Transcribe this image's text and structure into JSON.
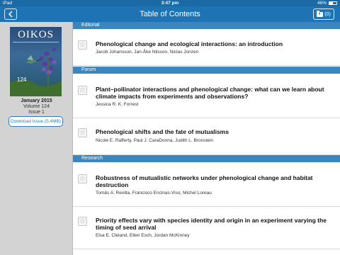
{
  "status": {
    "device": "iPad",
    "time": "3:47 pm",
    "battery": "46%",
    "battery_level": 0.46
  },
  "nav": {
    "back_icon": "chevron-left-icon",
    "title": "Table of Contents",
    "downloads_count": "(0)",
    "downloads_icon": "folder-download-icon"
  },
  "issue": {
    "cover_logo": "OIKOS",
    "cover_number": "124",
    "date": "January 2015",
    "volume": "Volume 124",
    "number": "Issue 1",
    "download_label": "Download Issue (5.4MB)"
  },
  "sections": [
    {
      "name": "Editorial"
    },
    {
      "name": "Forum"
    },
    {
      "name": "Research"
    }
  ],
  "articles": [
    {
      "title": "Phenological change and ecological interactions: an introduction",
      "authors": "Jacob Johansson, Jan-Åke Nilsson, Niclas Jonzen"
    },
    {
      "title": "Plant–pollinator interactions and phenological change: what can we learn about climate impacts from experiments and observations?",
      "authors": "Jessica R. K. Forrest"
    },
    {
      "title": "Phenological shifts and the fate of mutualisms",
      "authors": "Nicole E. Rafferty, Paul J. CaraDonna, Judith L. Bronstein"
    },
    {
      "title": "Robustness of mutualistic networks under phenological change and habitat destruction",
      "authors": "Tomás A. Revilla, Francisco Encinas-Viso, Michel Loreau"
    },
    {
      "title": "Priority effects vary with species identity and origin in an experiment varying the timing of seed arrival",
      "authors": "Elsa E. Cleland, Ellen Esch, Jordan McKinney"
    }
  ],
  "colors": {
    "nav": "#1d73b4",
    "section": "#3b86bf",
    "accent": "#2f7cc4",
    "sidebar": "#d3d3d3"
  }
}
